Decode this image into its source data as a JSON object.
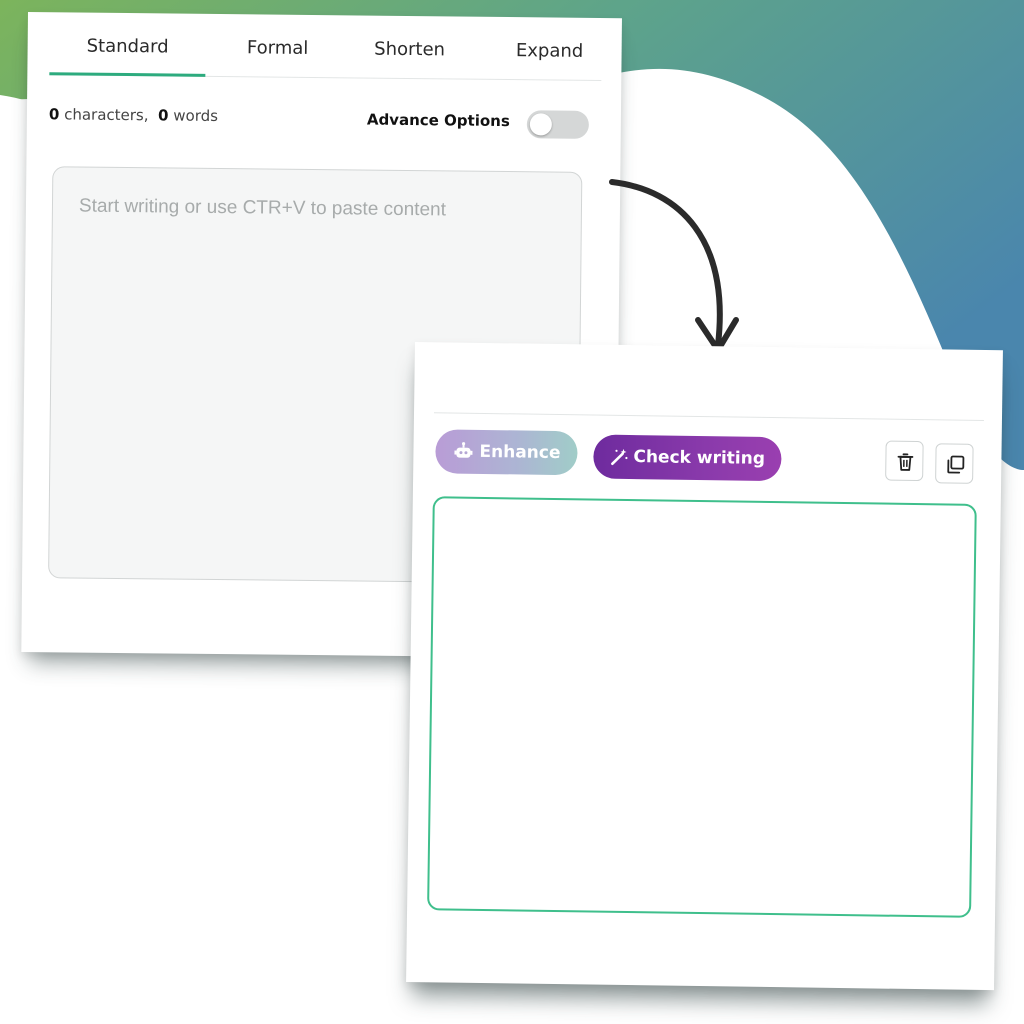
{
  "colors": {
    "accent_green": "#2dab7e",
    "output_border": "#3fbf8c",
    "check_purple": "#7b31a4",
    "bg_gradient_start": "#7cb45c",
    "bg_gradient_end": "#4a86ad"
  },
  "tabs": [
    {
      "label": "Standard",
      "active": true
    },
    {
      "label": "Formal",
      "active": false
    },
    {
      "label": "Shorten",
      "active": false
    },
    {
      "label": "Expand",
      "active": false
    }
  ],
  "counter": {
    "characters_count": "0",
    "characters_label": "characters,",
    "words_count": "0",
    "words_label": "words"
  },
  "advance_options": {
    "label": "Advance Options",
    "enabled": false
  },
  "input": {
    "placeholder": "Start writing or use CTR+V to paste content",
    "value": ""
  },
  "output": {
    "enhance_label": "Enhance",
    "enhance_icon": "robot-icon",
    "check_label": "Check writing",
    "check_icon": "magic-wand-icon",
    "delete_icon": "trash-icon",
    "copy_icon": "copy-icon",
    "value": ""
  }
}
